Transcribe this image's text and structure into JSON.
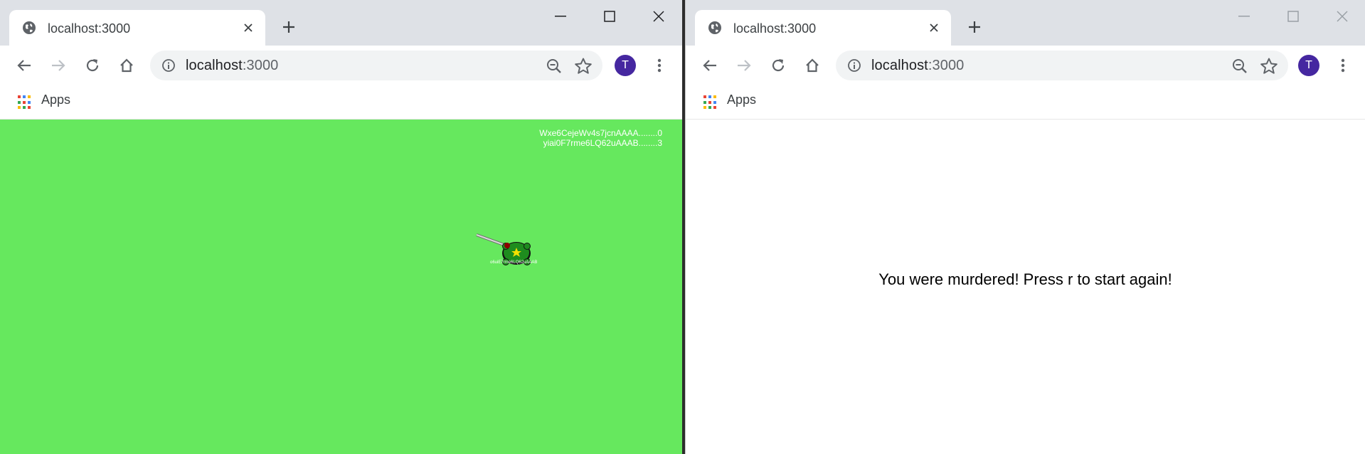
{
  "left_window": {
    "tab": {
      "title": "localhost:3000",
      "favicon": "globe-icon"
    },
    "address": {
      "host": "localhost",
      "port": ":3000"
    },
    "profile_initial": "T",
    "bookmarks": {
      "apps_label": "Apps"
    },
    "game": {
      "background_color": "#66e85e",
      "leaderboard": [
        {
          "entry": "Wxe6CejeWv4s7jcnAAAA........0"
        },
        {
          "entry": "yiai0F7rme6LQ62uAAAB........3"
        }
      ],
      "player_label": "o6uiE7rme6LQ62uAAAB"
    }
  },
  "right_window": {
    "tab": {
      "title": "localhost:3000",
      "favicon": "globe-icon"
    },
    "address": {
      "host": "localhost",
      "port": ":3000"
    },
    "profile_initial": "T",
    "bookmarks": {
      "apps_label": "Apps"
    },
    "message": "You were murdered! Press r to start again!"
  },
  "colors": {
    "tabstrip": "#dee1e6",
    "avatar": "#4527a0",
    "game_green": "#66e85e"
  }
}
